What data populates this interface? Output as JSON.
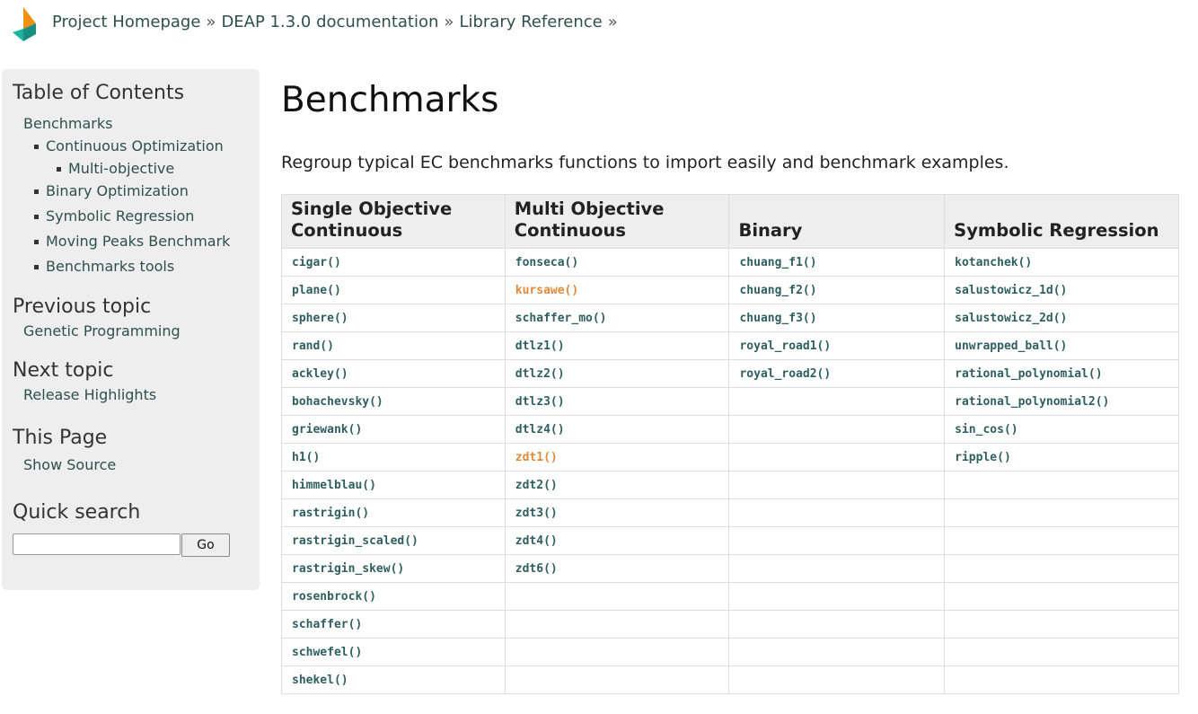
{
  "header": {
    "breadcrumb": [
      "Project Homepage",
      "DEAP 1.3.0 documentation",
      "Library Reference"
    ],
    "separator": "»"
  },
  "sidebar": {
    "toc_title": "Table of Contents",
    "toc_root": "Benchmarks",
    "toc_items": [
      "Continuous Optimization",
      "Binary Optimization",
      "Symbolic Regression",
      "Moving Peaks Benchmark",
      "Benchmarks tools"
    ],
    "toc_subitem": "Multi-objective",
    "prev_title": "Previous topic",
    "prev_link": "Genetic Programming",
    "next_title": "Next topic",
    "next_link": "Release Highlights",
    "this_page_title": "This Page",
    "show_source": "Show Source",
    "search_title": "Quick search",
    "search_value": "",
    "search_button": "Go"
  },
  "main": {
    "title": "Benchmarks",
    "intro": "Regroup typical EC benchmarks functions to import easily and benchmark examples."
  },
  "table": {
    "headers": [
      "Single Objective Continuous",
      "Multi Objective Continuous",
      "Binary",
      "Symbolic Regression"
    ],
    "columns": [
      [
        "cigar()",
        "plane()",
        "sphere()",
        "rand()",
        "ackley()",
        "bohachevsky()",
        "griewank()",
        "h1()",
        "himmelblau()",
        "rastrigin()",
        "rastrigin_scaled()",
        "rastrigin_skew()",
        "rosenbrock()",
        "schaffer()",
        "schwefel()",
        "shekel()"
      ],
      [
        "fonseca()",
        "kursawe()",
        "schaffer_mo()",
        "dtlz1()",
        "dtlz2()",
        "dtlz3()",
        "dtlz4()",
        "zdt1()",
        "zdt2()",
        "zdt3()",
        "zdt4()",
        "zdt6()"
      ],
      [
        "chuang_f1()",
        "chuang_f2()",
        "chuang_f3()",
        "royal_road1()",
        "royal_road2()"
      ],
      [
        "kotanchek()",
        "salustowicz_1d()",
        "salustowicz_2d()",
        "unwrapped_ball()",
        "rational_polynomial()",
        "rational_polynomial2()",
        "sin_cos()",
        "ripple()"
      ]
    ],
    "visited": [
      "kursawe()",
      "zdt1()"
    ]
  },
  "colors": {
    "link": "#2f5f5f",
    "visited_link": "#e08a3c",
    "sidebar_bg": "#eeeeee",
    "header_bg": "#eeeeee",
    "logo_orange": "#f29111",
    "logo_teal": "#1a9e8f"
  }
}
